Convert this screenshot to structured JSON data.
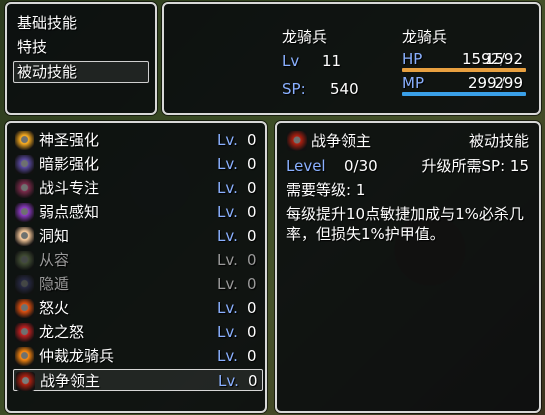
{
  "command_menu": {
    "items": [
      "基础技能",
      "特技",
      "被动技能"
    ],
    "selected_index": 2
  },
  "status": {
    "class_name": "龙骑兵",
    "character_name": "龙骑兵",
    "lv_label": "Lv",
    "lv_value": "11",
    "sp_label": "SP:",
    "sp_value": "540",
    "hp_label": "HP",
    "hp_current": "1592",
    "hp_max": "1592",
    "hp_fraction": 1.0,
    "hp_color": "#e8a040",
    "mp_label": "MP",
    "mp_current": "299",
    "mp_max": "299",
    "mp_fraction": 1.0,
    "mp_color": "#3aa0e8"
  },
  "skill_list": {
    "lv_label": "Lv.",
    "items": [
      {
        "name": "神圣强化",
        "value": "0",
        "icon": "holy-icon",
        "color": "#ffb020",
        "enabled": true
      },
      {
        "name": "暗影强化",
        "value": "0",
        "icon": "shadow-icon",
        "color": "#5a4aa0",
        "enabled": true
      },
      {
        "name": "战斗专注",
        "value": "0",
        "icon": "crossed-swords-icon",
        "color": "#7a2a4a",
        "enabled": true
      },
      {
        "name": "弱点感知",
        "value": "0",
        "icon": "weakness-icon",
        "color": "#8a3ac0",
        "enabled": true
      },
      {
        "name": "洞知",
        "value": "0",
        "icon": "insight-icon",
        "color": "#ffd0a0",
        "enabled": true
      },
      {
        "name": "从容",
        "value": "0",
        "icon": "calm-icon",
        "color": "#6a7a50",
        "enabled": false
      },
      {
        "name": "隐遁",
        "value": "0",
        "icon": "stealth-icon",
        "color": "#3a3a6a",
        "enabled": false
      },
      {
        "name": "怒火",
        "value": "0",
        "icon": "fury-icon",
        "color": "#e05010",
        "enabled": true
      },
      {
        "name": "龙之怒",
        "value": "0",
        "icon": "dragon-rage-icon",
        "color": "#c02020",
        "enabled": true
      },
      {
        "name": "仲裁龙骑兵",
        "value": "0",
        "icon": "arbiter-icon",
        "color": "#ff8a10",
        "enabled": true
      },
      {
        "name": "战争领主",
        "value": "0",
        "icon": "warlord-icon",
        "color": "#b02010",
        "enabled": true
      }
    ],
    "selected_index": 10
  },
  "detail": {
    "skill_name": "战争领主",
    "skill_type": "被动技能",
    "icon": "warlord-icon",
    "icon_color": "#b02010",
    "level_label": "Level",
    "level_value": "0/30",
    "sp_required": "升级所需SP: 15",
    "required_level": "需要等级: 1",
    "description_line1": "每级提升10点敏捷加成与1%必杀几",
    "description_line2": "率，但损失1%护甲值。"
  }
}
